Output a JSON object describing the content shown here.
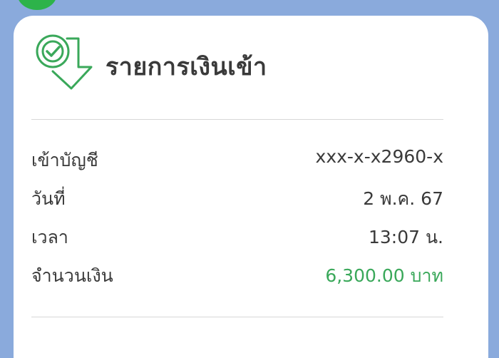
{
  "colors": {
    "background": "#8aaadc",
    "card": "#ffffff",
    "accent_green": "#2db34a",
    "amount_green": "#3aa85a",
    "text": "#3a3a3a"
  },
  "header": {
    "icon": "check-down-arrow-icon",
    "title": "รายการเงินเข้า"
  },
  "details": [
    {
      "label": "เข้าบัญชี",
      "value": "xxx-x-x2960-x"
    },
    {
      "label": "วันที่",
      "value": "2 พ.ค. 67"
    },
    {
      "label": "เวลา",
      "value": "13:07 น."
    },
    {
      "label": "จำนวนเงิน",
      "value": "6,300.00 บาท"
    }
  ]
}
